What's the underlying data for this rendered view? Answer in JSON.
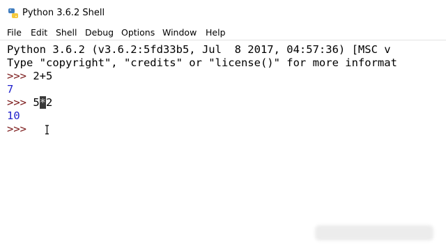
{
  "window": {
    "title": "Python 3.6.2 Shell"
  },
  "menu": {
    "items": [
      "File",
      "Edit",
      "Shell",
      "Debug",
      "Options",
      "Window",
      "Help"
    ]
  },
  "shell": {
    "banner_line1": "Python 3.6.2 (v3.6.2:5fd33b5, Jul  8 2017, 04:57:36) [MSC v",
    "banner_line2": "Type \"copyright\", \"credits\" or \"license()\" for more informat",
    "prompt": ">>> ",
    "entries": [
      {
        "input": "2+5",
        "output": "7"
      },
      {
        "input_before": "5",
        "input_selected": "*",
        "input_after": "2",
        "output": "10"
      }
    ],
    "current_prompt": ">>> "
  },
  "colors": {
    "prompt": "#7a1818",
    "output": "#2222cc",
    "text": "#000000",
    "selection": "#3a3a3a"
  }
}
